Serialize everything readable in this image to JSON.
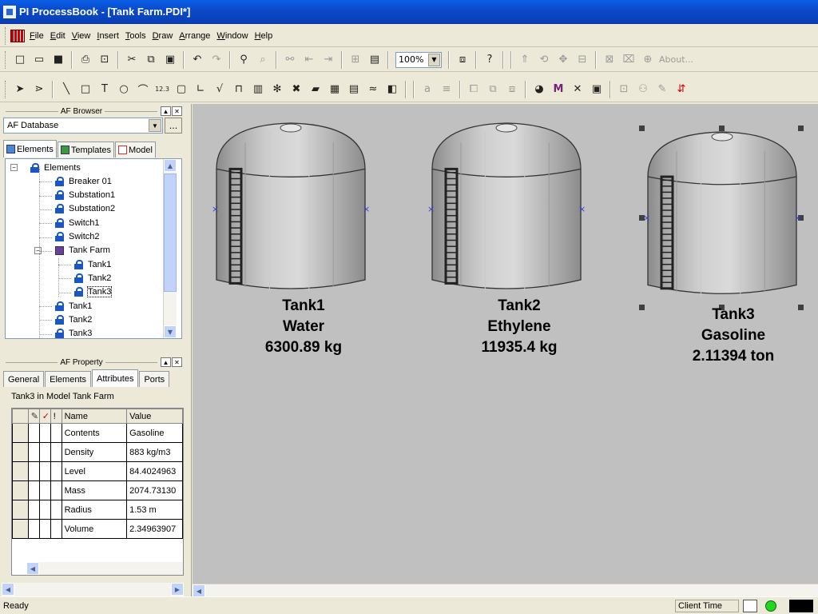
{
  "window": {
    "title": "PI ProcessBook - [Tank Farm.PDI*]"
  },
  "menu": [
    "File",
    "Edit",
    "View",
    "Insert",
    "Tools",
    "Draw",
    "Arrange",
    "Window",
    "Help"
  ],
  "toolbar": {
    "zoom": "100%",
    "about_label": "About...",
    "level_label": "12.3"
  },
  "af_browser": {
    "caption": "AF Browser",
    "database": "AF Database",
    "browse_label": "...",
    "tabs": [
      "Elements",
      "Templates",
      "Model"
    ],
    "tree": [
      {
        "label": "Elements",
        "depth": 0,
        "kind": "root"
      },
      {
        "label": "Breaker 01",
        "depth": 1
      },
      {
        "label": "Substation1",
        "depth": 1
      },
      {
        "label": "Substation2",
        "depth": 1
      },
      {
        "label": "Switch1",
        "depth": 1
      },
      {
        "label": "Switch2",
        "depth": 1
      },
      {
        "label": "Tank Farm",
        "depth": 1,
        "kind": "folder"
      },
      {
        "label": "Tank1",
        "depth": 2
      },
      {
        "label": "Tank2",
        "depth": 2
      },
      {
        "label": "Tank3",
        "depth": 2,
        "selected": true
      },
      {
        "label": "Tank1",
        "depth": 1
      },
      {
        "label": "Tank2",
        "depth": 1
      },
      {
        "label": "Tank3",
        "depth": 1
      }
    ]
  },
  "af_property": {
    "caption": "AF Property",
    "tabs": [
      "General",
      "Elements",
      "Attributes",
      "Ports"
    ],
    "context": "Tank3 in Model Tank Farm",
    "columns": [
      "Name",
      "Value"
    ],
    "rows": [
      {
        "name": "Contents",
        "value": "Gasoline"
      },
      {
        "name": "Density",
        "value": "883 kg/m3"
      },
      {
        "name": "Level",
        "value": "84.4024963"
      },
      {
        "name": "Mass",
        "value": "2074.73130"
      },
      {
        "name": "Radius",
        "value": "1.53 m"
      },
      {
        "name": "Volume",
        "value": "2.34963907"
      }
    ]
  },
  "tanks": [
    {
      "name": "Tank1",
      "contents": "Water",
      "value": "6300.89 kg"
    },
    {
      "name": "Tank2",
      "contents": "Ethylene",
      "value": "11935.4 kg"
    },
    {
      "name": "Tank3",
      "contents": "Gasoline",
      "value": "2.11394 ton"
    }
  ],
  "status": {
    "text": "Ready",
    "clock": "Client Time"
  }
}
